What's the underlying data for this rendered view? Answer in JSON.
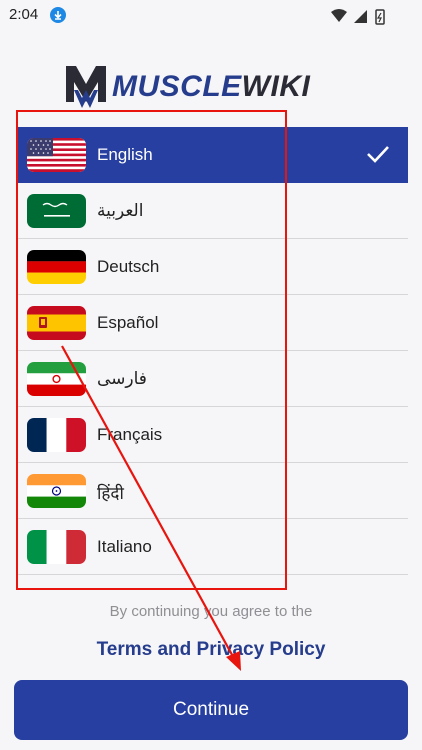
{
  "status_bar": {
    "time": "2:04"
  },
  "brand": {
    "part1": "MUSCLE",
    "part2": "WIKI"
  },
  "languages": [
    {
      "label": "English",
      "flag": "us-flag-icon",
      "selected": true
    },
    {
      "label": "العربية",
      "flag": "saudi-flag-icon",
      "selected": false
    },
    {
      "label": "Deutsch",
      "flag": "germany-flag-icon",
      "selected": false
    },
    {
      "label": "Español",
      "flag": "spain-flag-icon",
      "selected": false
    },
    {
      "label": "فارسی",
      "flag": "iran-flag-icon",
      "selected": false
    },
    {
      "label": "Français",
      "flag": "france-flag-icon",
      "selected": false
    },
    {
      "label": "हिंदी",
      "flag": "india-flag-icon",
      "selected": false
    },
    {
      "label": "Italiano",
      "flag": "italy-flag-icon",
      "selected": false
    }
  ],
  "consent_text": "By continuing you agree to the",
  "terms_link": "Terms and Privacy Policy",
  "continue_label": "Continue",
  "colors": {
    "primary": "#263fa0",
    "annotation": "#e8140e"
  }
}
